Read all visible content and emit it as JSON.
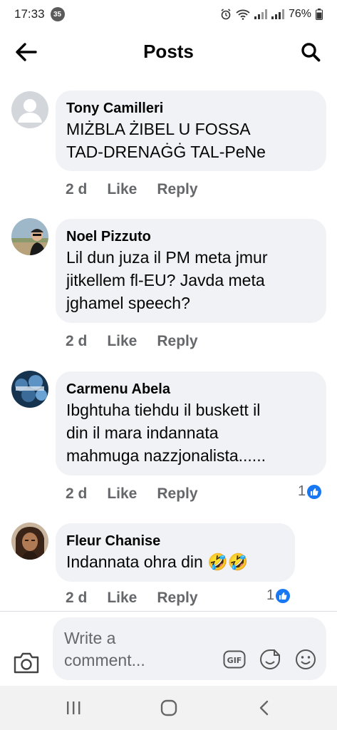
{
  "status_bar": {
    "time": "17:33",
    "notification_count": "35",
    "battery": "76%"
  },
  "header": {
    "title": "Posts",
    "back_icon": "arrow-left-icon",
    "search_icon": "search-icon"
  },
  "comments": [
    {
      "author": "Tony Camilleri",
      "text": "MIŻBLA ŻIBEL U FOSSA\nTAD-DRENAĠĠ TAL-PeNe",
      "time": "2 d",
      "like_label": "Like",
      "reply_label": "Reply",
      "reactions": ""
    },
    {
      "author": "Noel Pizzuto",
      "text": "Lil dun juza il PM meta jmur\njitkellem fl-EU? Javda meta\njghamel speech?",
      "time": "2 d",
      "like_label": "Like",
      "reply_label": "Reply",
      "reactions": ""
    },
    {
      "author": "Carmenu Abela",
      "text": "Ibghtuha tiehdu il buskett il\ndin il mara indannata\nmahmuga nazzjonalista......",
      "time": "2 d",
      "like_label": "Like",
      "reply_label": "Reply",
      "reactions": "1"
    },
    {
      "author": "Fleur Chanise",
      "text": "Indannata ohra din 🤣🤣",
      "time": "2 d",
      "like_label": "Like",
      "reply_label": "Reply",
      "reactions": "1"
    }
  ],
  "composer": {
    "placeholder": "Write a\ncomment...",
    "gif_label": "GIF"
  },
  "colors": {
    "bubble": "#f0f2f5",
    "accent": "#1877f2",
    "secondary_text": "#65676b"
  }
}
